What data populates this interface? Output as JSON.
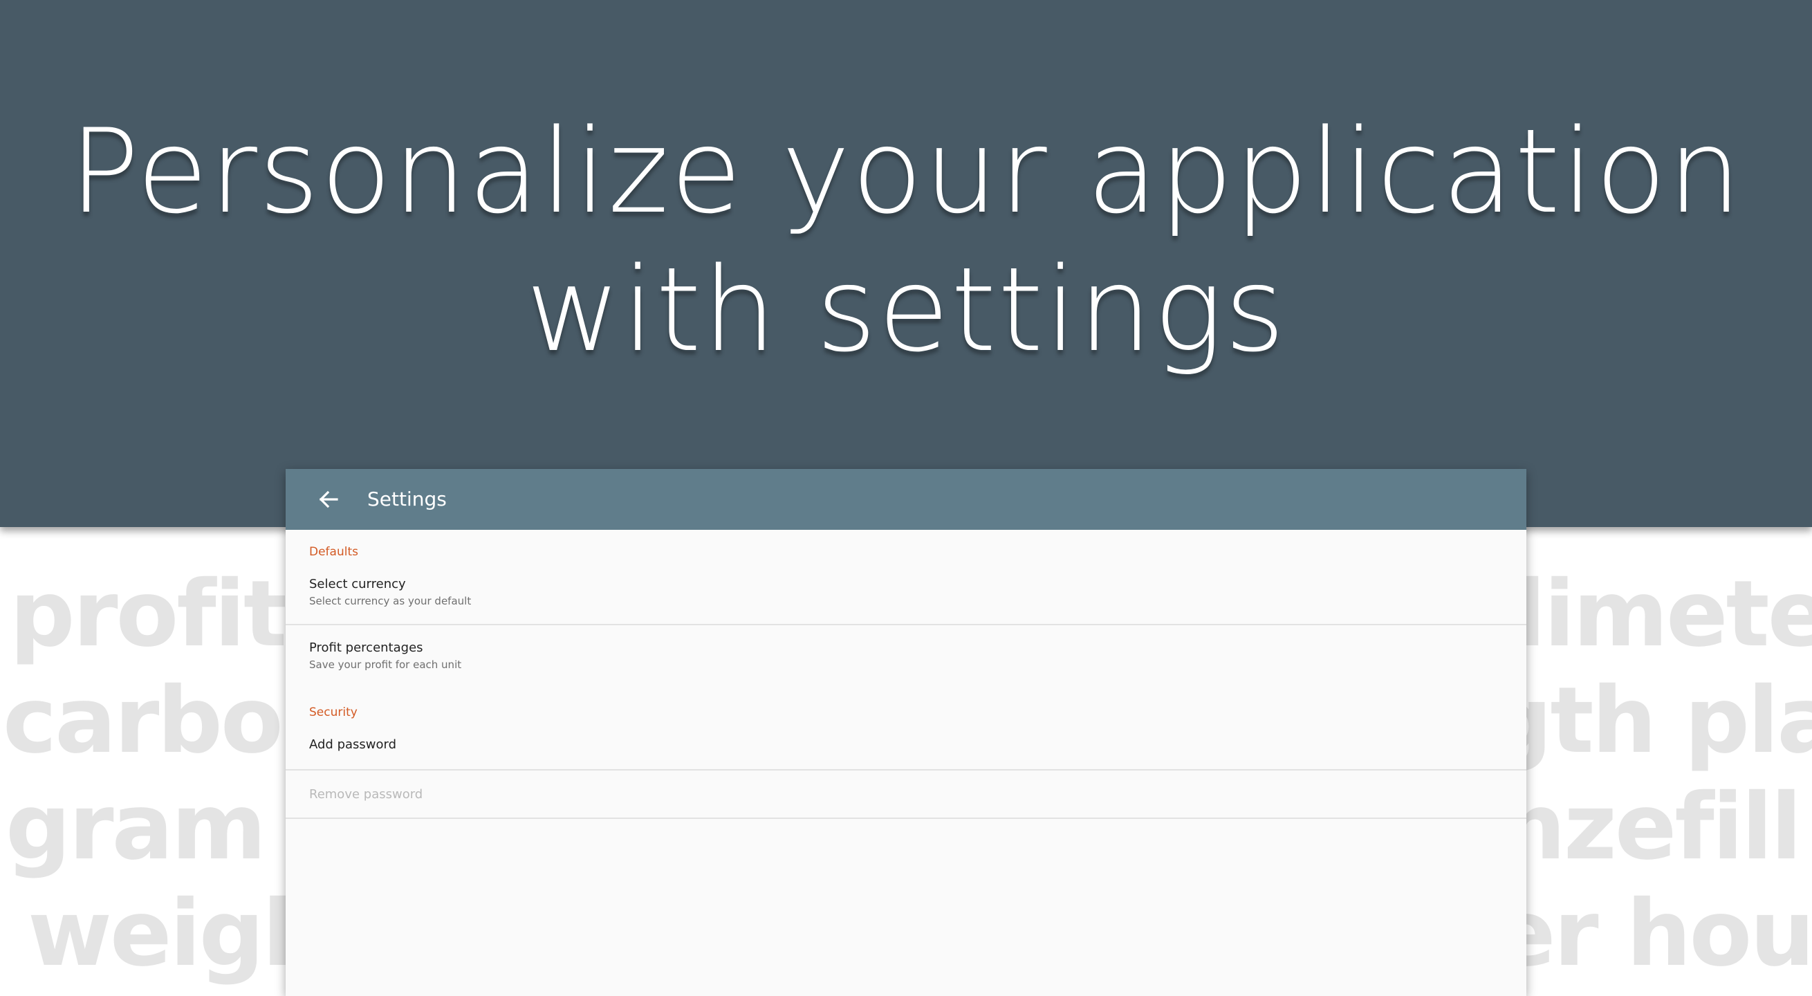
{
  "hero": {
    "headline_line1": "Personalize your application",
    "headline_line2": "with settings"
  },
  "background_words": {
    "left": [
      "profit",
      "carbon",
      "gram m",
      "weigh"
    ],
    "right": [
      "limete",
      "gth pla",
      "nzefill",
      "er hour"
    ]
  },
  "toolbar": {
    "back_icon": "arrow-back-icon",
    "title": "Settings"
  },
  "settings": {
    "sections": [
      {
        "header": "Defaults",
        "items": [
          {
            "title": "Select currency",
            "summary": "Select currency as your default",
            "enabled": true
          },
          {
            "title": "Profit percentages",
            "summary": "Save your profit for each unit",
            "enabled": true
          }
        ]
      },
      {
        "header": "Security",
        "items": [
          {
            "title": "Add password",
            "summary": "",
            "enabled": true
          },
          {
            "title": "Remove password",
            "summary": "",
            "enabled": false
          }
        ]
      }
    ]
  },
  "colors": {
    "hero_background": "#485a66",
    "toolbar": "#607d8b",
    "section_header": "#d35a24",
    "window_background": "#fafafa",
    "background_word": "#e4e4e4"
  }
}
